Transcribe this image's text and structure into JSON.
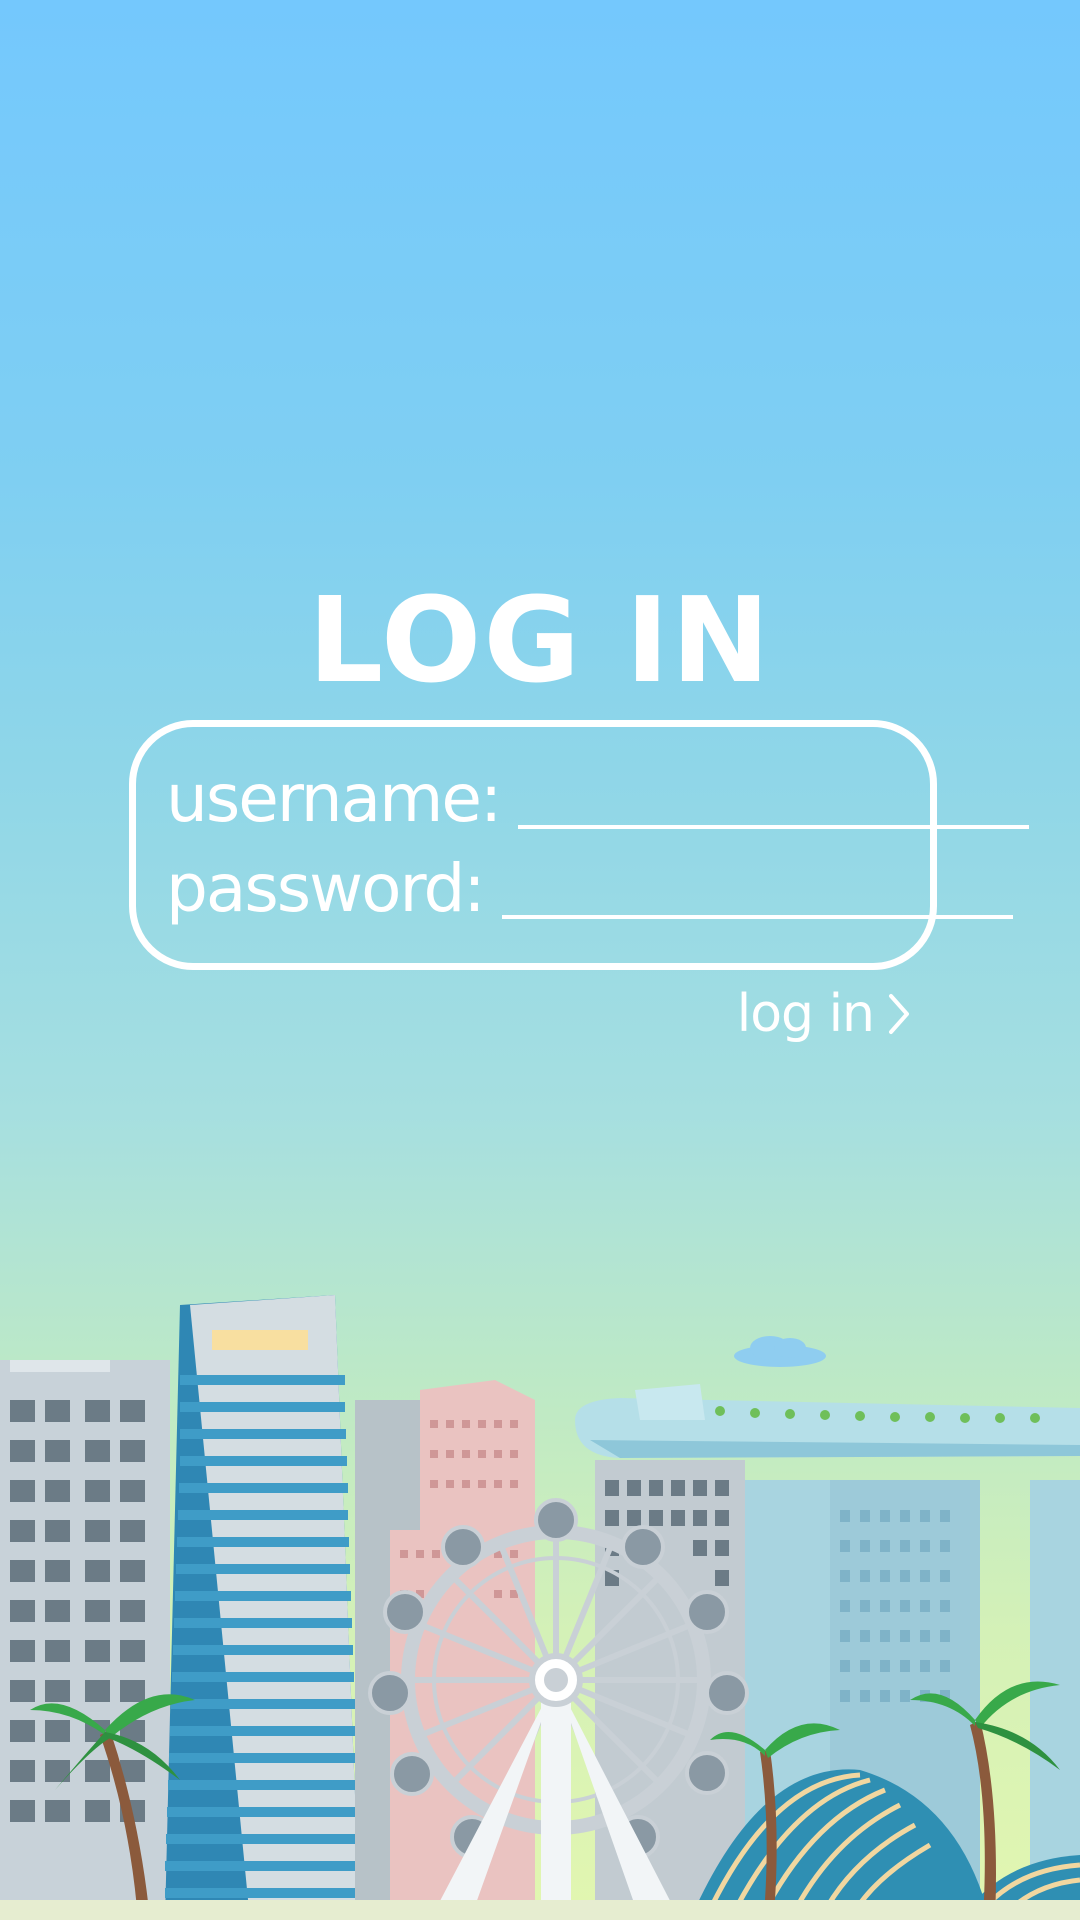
{
  "title": "LOG IN",
  "form": {
    "username_label": "username:",
    "username_value": "",
    "password_label": "password:",
    "password_value": ""
  },
  "submit_label": "log in",
  "icons": {
    "submit": "chevron-right-icon",
    "scene": "city-skyline-illustration"
  },
  "colors": {
    "sky_top": "#74c8fd",
    "sky_bottom": "#e2f6b0",
    "text": "#ffffff"
  }
}
